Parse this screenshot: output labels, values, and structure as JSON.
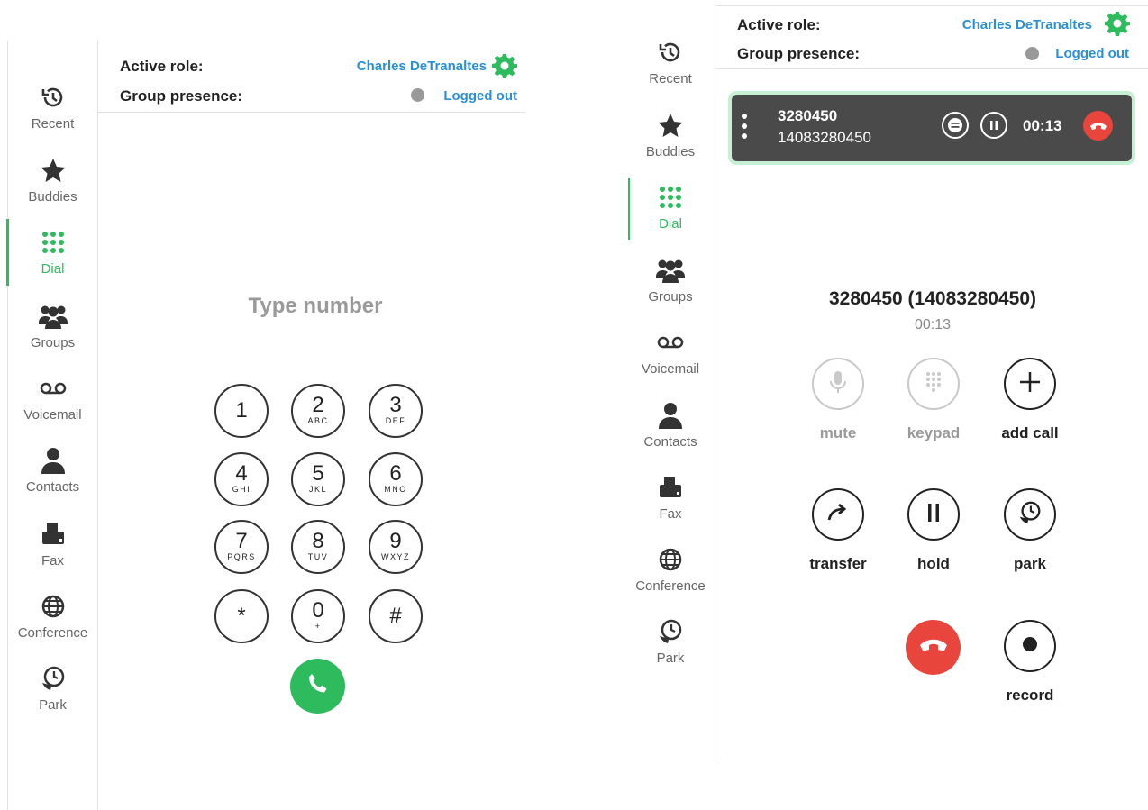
{
  "nav": {
    "recent": "Recent",
    "buddies": "Buddies",
    "dial": "Dial",
    "groups": "Groups",
    "voicemail": "Voicemail",
    "contacts": "Contacts",
    "fax": "Fax",
    "conference": "Conference",
    "park": "Park"
  },
  "header": {
    "active_role_label": "Active role:",
    "active_role_name": "Charles DeTranaltes",
    "group_presence_label": "Group presence:",
    "presence_status": "Logged out"
  },
  "dialer": {
    "input_placeholder": "Type number",
    "keys": [
      {
        "digit": "1",
        "letters": ""
      },
      {
        "digit": "2",
        "letters": "ABC"
      },
      {
        "digit": "3",
        "letters": "DEF"
      },
      {
        "digit": "4",
        "letters": "GHI"
      },
      {
        "digit": "5",
        "letters": "JKL"
      },
      {
        "digit": "6",
        "letters": "MNO"
      },
      {
        "digit": "7",
        "letters": "PQRS"
      },
      {
        "digit": "8",
        "letters": "TUV"
      },
      {
        "digit": "9",
        "letters": "WXYZ"
      },
      {
        "digit": "*",
        "letters": ""
      },
      {
        "digit": "0",
        "letters": "+"
      },
      {
        "digit": "#",
        "letters": ""
      }
    ]
  },
  "call_bar": {
    "number": "3280450",
    "full_number": "14083280450",
    "timer": "00:13"
  },
  "active_call": {
    "title": "3280450 (14083280450)",
    "timer": "00:13",
    "mute": "mute",
    "keypad": "keypad",
    "add_call": "add call",
    "transfer": "transfer",
    "hold": "hold",
    "park": "park",
    "record": "record"
  },
  "colors": {
    "accent_green": "#2dbb5d",
    "link_blue": "#2b8fd6",
    "hangup_red": "#e8453c",
    "call_bar_bg": "#4a4a4a"
  }
}
